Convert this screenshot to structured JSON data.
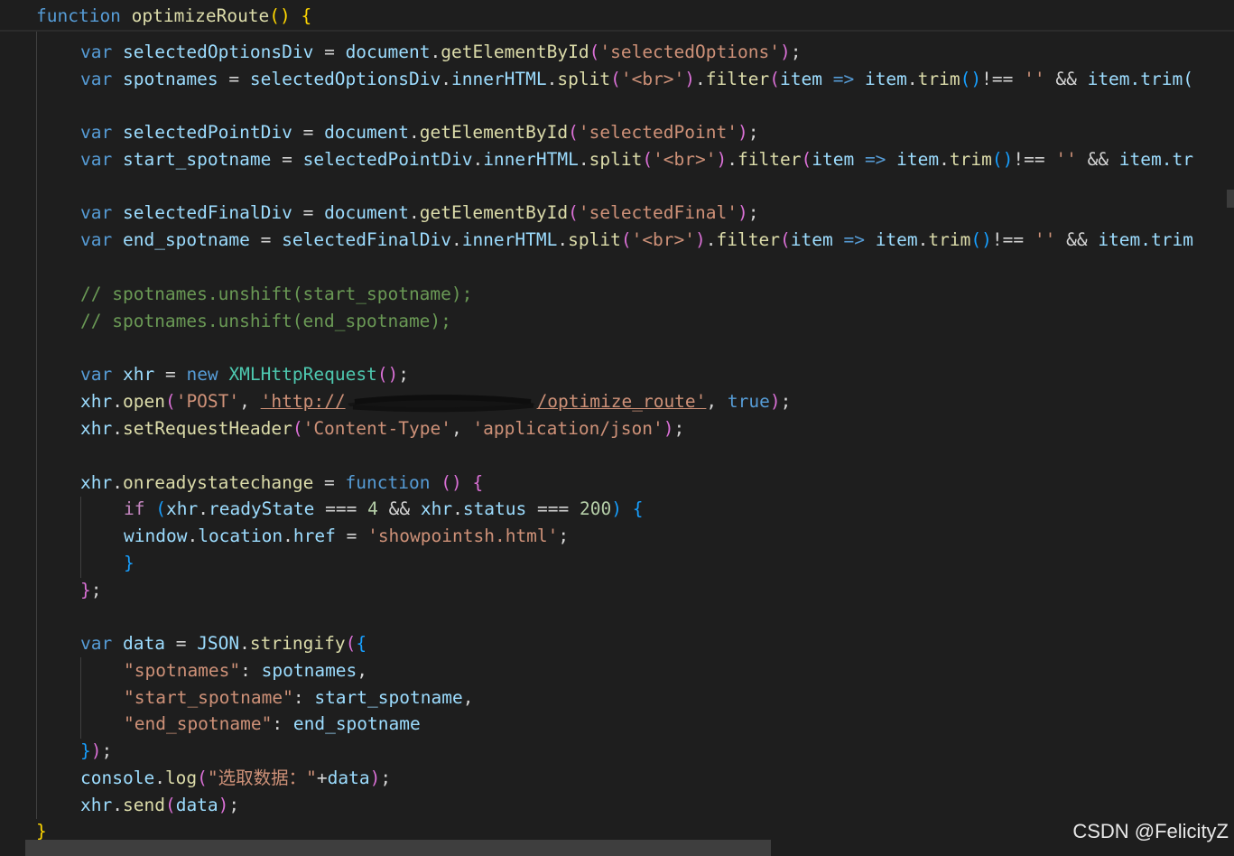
{
  "code": {
    "line_header": {
      "kw_function": "function",
      "fn_name": "optimizeRoute",
      "parens": "()",
      "brace_open": "{"
    },
    "line_selectedOptionsDiv": {
      "kw": "var",
      "name": "selectedOptionsDiv",
      "eq": "=",
      "obj": "document",
      "method": "getElementById",
      "arg": "'selectedOptions'",
      "end": ";"
    },
    "line_spotnames": {
      "kw": "var",
      "name": "spotnames",
      "rhs_obj": "selectedOptionsDiv",
      "rhs_prop": "innerHTML",
      "split": "split",
      "split_arg": "'<br>'",
      "filter": "filter",
      "param": "item",
      "arrow": "=>",
      "trim_obj": "item",
      "trim": "trim",
      "neq": "!==",
      "empty": "''",
      "and": "&&",
      "tail": "item.trim("
    },
    "line_selectedPointDiv": {
      "kw": "var",
      "name": "selectedPointDiv",
      "obj": "document",
      "method": "getElementById",
      "arg": "'selectedPoint'"
    },
    "line_start_spotname": {
      "kw": "var",
      "name": "start_spotname",
      "rhs_obj": "selectedPointDiv",
      "tail": "item.tr"
    },
    "line_selectedFinalDiv": {
      "kw": "var",
      "name": "selectedFinalDiv",
      "obj": "document",
      "method": "getElementById",
      "arg": "'selectedFinal'"
    },
    "line_end_spotname": {
      "kw": "var",
      "name": "end_spotname",
      "rhs_obj": "selectedFinalDiv",
      "tail": "item.trim"
    },
    "comment_1": "// spotnames.unshift(start_spotname);",
    "comment_2": "// spotnames.unshift(end_spotname);",
    "line_xhr": {
      "kw": "var",
      "name": "xhr",
      "new": "new",
      "cls": "XMLHttpRequest"
    },
    "line_open": {
      "obj": "xhr",
      "method": "open",
      "method_arg": "'POST'",
      "url_start": "'http://",
      "url_end": "/optimize_route'",
      "bool": "true"
    },
    "line_header_set": {
      "obj": "xhr",
      "method": "setRequestHeader",
      "arg1": "'Content-Type'",
      "arg2": "'application/json'"
    },
    "line_onready": {
      "obj": "xhr",
      "prop": "onreadystatechange",
      "kw": "function"
    },
    "line_if": {
      "kw": "if",
      "obj1": "xhr",
      "prop1": "readyState",
      "op": "===",
      "num1": "4",
      "and": "&&",
      "obj2": "xhr",
      "prop2": "status",
      "num2": "200"
    },
    "line_location": {
      "obj": "window",
      "prop1": "location",
      "prop2": "href",
      "value": "'showpointsh.html'"
    },
    "line_data": {
      "kw": "var",
      "name": "data",
      "obj": "JSON",
      "method": "stringify"
    },
    "json_keys": [
      {
        "key": "\"spotnames\"",
        "value": "spotnames",
        "sep": ","
      },
      {
        "key": "\"start_spotname\"",
        "value": "start_spotname",
        "sep": ","
      },
      {
        "key": "\"end_spotname\"",
        "value": "end_spotname",
        "sep": ""
      }
    ],
    "line_console": {
      "obj": "console",
      "method": "log",
      "str": "\"选取数据：\"",
      "arg": "data"
    },
    "line_send": {
      "obj": "xhr",
      "method": "send",
      "arg": "data"
    },
    "closing_brace": "}"
  },
  "watermark": "CSDN @FelicityZ",
  "colors": {
    "background": "#1e1e1e",
    "keyword": "#569cd6",
    "function": "#dcdcaa",
    "variable": "#9cdcfe",
    "string": "#ce9178",
    "comment": "#6a9955",
    "class": "#4ec9b0"
  }
}
